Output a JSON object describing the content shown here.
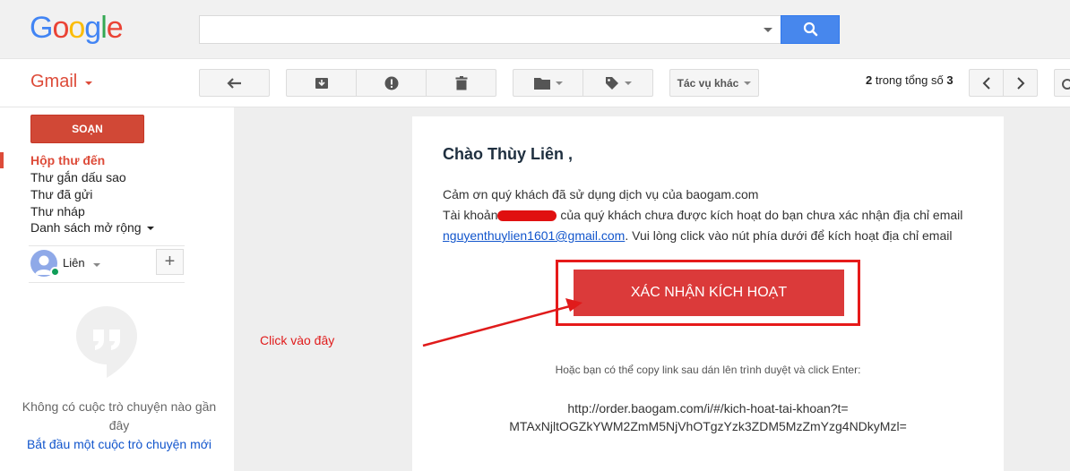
{
  "header": {
    "logo": [
      "G",
      "o",
      "o",
      "g",
      "l",
      "e"
    ],
    "logo_colors": [
      "#4285f4",
      "#ea4335",
      "#fbbc05",
      "#4285f4",
      "#34a853",
      "#ea4335"
    ],
    "search_placeholder": ""
  },
  "toolbar": {
    "app_name": "Gmail",
    "more_actions": "Tác vụ khác",
    "pager_current": "2",
    "pager_text": " trong tổng số ",
    "pager_total": "3"
  },
  "sidebar": {
    "compose": "SOẠN",
    "items": [
      "Hộp thư đến",
      "Thư gắn dấu sao",
      "Thư đã gửi",
      "Thư nháp",
      "Danh sách mở rộng"
    ],
    "chat_user": "Liên",
    "no_chat": "Không có cuộc trò chuyện nào gần đây",
    "start_chat": "Bắt đầu một cuộc trò chuyện mới"
  },
  "email": {
    "greeting": "Chào Thùy Liên ,",
    "line1": "Cảm ơn quý khách đã sử dụng dịch vụ của baogam.com",
    "line2_prefix": "Tài khoản",
    "line2_suffix": " của quý khách chưa được kích hoạt do bạn chưa xác nhận địa chỉ email",
    "email_link": "nguyenthuylien1601@gmail.com",
    "line3_suffix": ". Vui lòng click vào nút phía dưới để kích hoạt địa chỉ email",
    "button": "XÁC NHẬN KÍCH HOẠT",
    "copy_hint": "Hoặc bạn có thể copy link sau dán lên trình duyệt và click Enter:",
    "link_line1": "http://order.baogam.com/i/#/kich-hoat-tai-khoan?t=",
    "link_line2": "MTAxNjltOGZkYWM2ZmM5NjVhOTgzYzk3ZDM5MzZmYzg4NDkyMzl="
  },
  "annotation": {
    "click_here": "Click vào đây",
    "color": "#e01b1b"
  }
}
